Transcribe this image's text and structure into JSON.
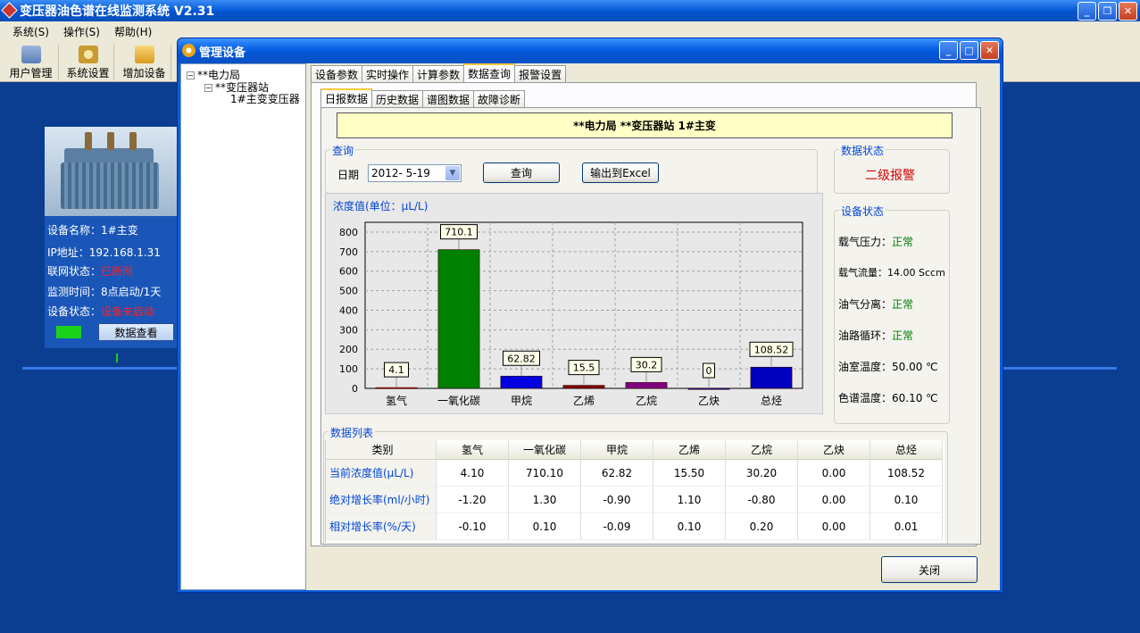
{
  "app": {
    "title": "变压器油色谱在线监测系统 V2.31"
  },
  "menu": [
    "系统(S)",
    "操作(S)",
    "帮助(H)"
  ],
  "toolbar": [
    {
      "label": "用户管理",
      "icon": "user-management-icon"
    },
    {
      "label": "系统设置",
      "icon": "system-settings-icon"
    },
    {
      "label": "增加设备",
      "icon": "add-device-icon"
    }
  ],
  "device": {
    "name": "设备名称：1#主变",
    "ip": "IP地址：192.168.1.31",
    "network_label": "联网状态：",
    "network_value": "已断网",
    "monitor_time": "监测时间：8点启动/1天",
    "status_label": "设备状态：",
    "status_value": "设备未启动",
    "data_button": "数据查看"
  },
  "dialog": {
    "title": "管理设备",
    "tree": {
      "root": "**电力局",
      "station": "**变压器站",
      "leaf": "1#主变变压器"
    },
    "tabs": [
      "设备参数",
      "实时操作",
      "计算参数",
      "数据查询",
      "报警设置"
    ],
    "active_tab": "数据查询",
    "subtabs": [
      "日报数据",
      "历史数据",
      "谱图数据",
      "故障诊断"
    ],
    "active_subtab": "日报数据",
    "banner": "**电力局 **变压器站 1#主变",
    "query": {
      "group_label": "查询",
      "date_label": "日期",
      "date_value": "2012- 5-19",
      "query_button": "查询",
      "excel_button": "输出到Excel"
    },
    "data_status": {
      "label": "数据状态",
      "value": "二级报警",
      "color": "#d40000"
    },
    "device_status": {
      "label": "设备状态",
      "rows": [
        {
          "label": "载气压力：",
          "value": "正常",
          "ok": true
        },
        {
          "label": "载气流量：",
          "value": "14.00 Sccm",
          "ok": false
        },
        {
          "label": "油气分离：",
          "value": "正常",
          "ok": true
        },
        {
          "label": "油路循环：",
          "value": "正常",
          "ok": true
        },
        {
          "label": "油室温度：",
          "value": "50.00 ℃",
          "ok": false
        },
        {
          "label": "色谱温度：",
          "value": "60.10 ℃",
          "ok": false
        }
      ]
    },
    "table": {
      "group_label": "数据列表",
      "headers": [
        "类别",
        "氢气",
        "一氧化碳",
        "甲烷",
        "乙烯",
        "乙烷",
        "乙炔",
        "总烃"
      ],
      "rows": [
        {
          "label": "当前浓度值(μL/L)",
          "values": [
            "4.10",
            "710.10",
            "62.82",
            "15.50",
            "30.20",
            "0.00",
            "108.52"
          ]
        },
        {
          "label": "绝对增长率(ml/小时)",
          "values": [
            "-1.20",
            "1.30",
            "-0.90",
            "1.10",
            "-0.80",
            "0.00",
            "0.10"
          ]
        },
        {
          "label": "相对增长率(%/天)",
          "values": [
            "-0.10",
            "0.10",
            "-0.09",
            "0.10",
            "0.20",
            "0.00",
            "0.01"
          ]
        }
      ]
    },
    "close_button": "关闭"
  },
  "chart_data": {
    "type": "bar",
    "title": "浓度值(单位：μL/L)",
    "categories": [
      "氢气",
      "一氧化碳",
      "甲烷",
      "乙烯",
      "乙烷",
      "乙炔",
      "总烃"
    ],
    "values": [
      4.1,
      710.1,
      62.82,
      15.5,
      30.2,
      0,
      108.52
    ],
    "value_labels": [
      "4.1",
      "710.1",
      "62.82",
      "15.5",
      "30.2",
      "0",
      "108.52"
    ],
    "colors": [
      "#c00000",
      "#008000",
      "#0000e0",
      "#800000",
      "#800080",
      "#0000c0",
      "#0000c0"
    ],
    "ylim": [
      0,
      850
    ],
    "yticks": [
      0,
      100,
      200,
      300,
      400,
      500,
      600,
      700,
      800
    ],
    "grid": true
  }
}
